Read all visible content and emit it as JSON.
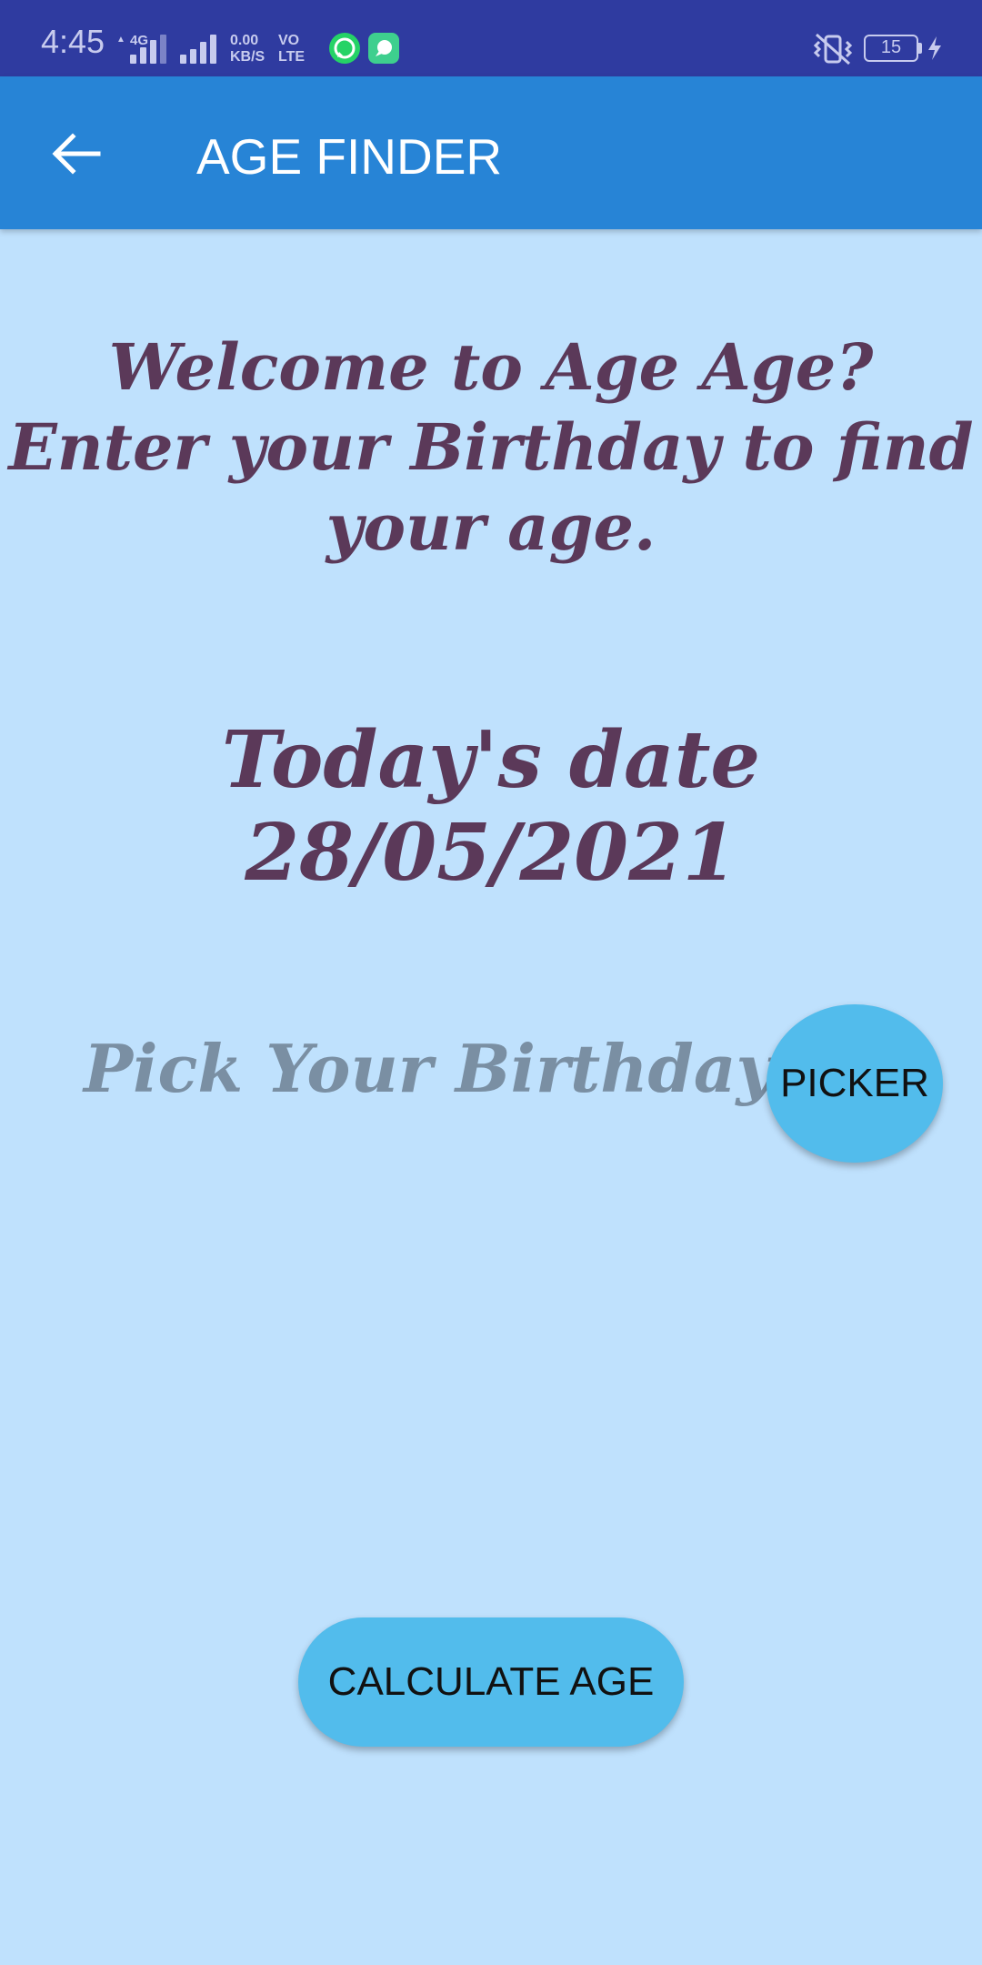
{
  "status_bar": {
    "time": "4:45",
    "network_4g": "4G",
    "speed_value": "0.00",
    "speed_unit": "KB/S",
    "volte_top": "VO",
    "volte_bottom": "LTE",
    "battery": "15",
    "icons": [
      "signal-4g-icon",
      "signal-icon",
      "whatsapp-icon",
      "chat-app-icon",
      "vibrate-icon",
      "battery-icon",
      "charging-icon"
    ]
  },
  "app_bar": {
    "back_icon": "arrow-back-icon",
    "title": "AGE FINDER"
  },
  "main": {
    "welcome_text": "Welcome to Age Age?\nEnter your Birthday to find\nyour age.",
    "today_label": "Today's date",
    "today_date": "28/05/2021",
    "birthday_placeholder": "Pick Your Birthday",
    "picker_button": "PICKER",
    "calculate_button": "CALCULATE AGE"
  },
  "colors": {
    "status_bar": "#2f3ba0",
    "app_bar": "#2784d6",
    "background": "#bfe1fd",
    "heading_text": "#5b3959",
    "placeholder_text": "#7a8fa3",
    "button": "#52bcec"
  }
}
